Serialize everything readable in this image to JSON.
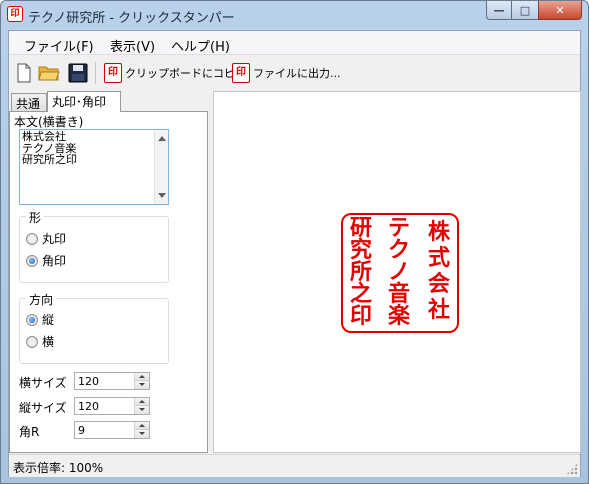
{
  "window": {
    "title": "テクノ研究所 - クリックスタンパー",
    "app_icon_glyph": "印"
  },
  "window_buttons": {
    "minimize": "—",
    "maximize": "□",
    "close": "✕"
  },
  "menu": {
    "items": [
      "ファイル(F)",
      "表示(V)",
      "ヘルプ(H)"
    ]
  },
  "toolbar": {
    "icons": [
      "new-file-icon",
      "open-folder-icon",
      "save-icon"
    ],
    "copy_label": "クリップボードにコピー",
    "export_label": "ファイルに出力...",
    "stamp_glyph": "印"
  },
  "tabs": {
    "common": "共通",
    "round_square": "丸印･角印"
  },
  "form": {
    "body_label": "本文(横書き)",
    "body_lines": [
      "株式会社",
      "テクノ音楽",
      "研究所之印"
    ],
    "shape_group": "形",
    "shape_options": [
      "丸印",
      "角印"
    ],
    "shape_selected": "角印",
    "direction_group": "方向",
    "direction_options": [
      "縦",
      "横"
    ],
    "direction_selected": "縦",
    "width_label": "横サイズ",
    "width_value": "120",
    "height_label": "縦サイズ",
    "height_value": "120",
    "radius_label": "角R",
    "radius_value": "9"
  },
  "stamp": {
    "columns": [
      "株式会社",
      "テクノ音楽",
      "研究所之印"
    ],
    "color": "#e30000"
  },
  "status": {
    "text": "表示倍率: 100%"
  },
  "colors": {
    "stamp_red": "#e30000",
    "titlebar": "#b9d1ea",
    "focus_border": "#7eb4ea"
  }
}
